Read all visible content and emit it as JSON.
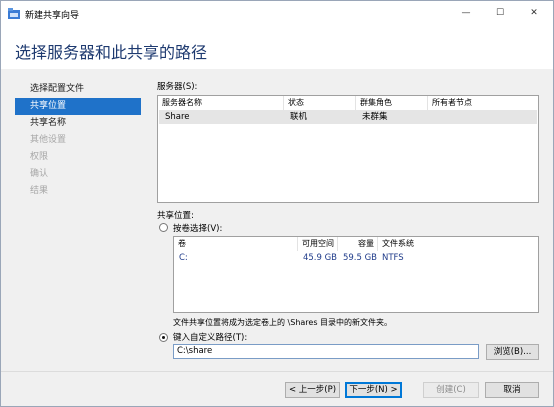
{
  "window": {
    "title": "新建共享向导",
    "minimize": "—",
    "maximize": "☐",
    "close": "✕"
  },
  "header": {
    "title": "选择服务器和此共享的路径"
  },
  "nav": {
    "items": [
      {
        "label": "选择配置文件"
      },
      {
        "label": "共享位置"
      },
      {
        "label": "共享名称"
      },
      {
        "label": "其他设置"
      },
      {
        "label": "权限"
      },
      {
        "label": "确认"
      },
      {
        "label": "结果"
      }
    ]
  },
  "servers": {
    "label": "服务器(S):",
    "columns": [
      "服务器名称",
      "状态",
      "群集角色",
      "所有者节点"
    ],
    "rows": [
      {
        "name": "Share",
        "status": "联机",
        "role": "未群集",
        "owner": ""
      }
    ]
  },
  "location": {
    "label": "共享位置:",
    "by_volume_label": "按卷选择(V):",
    "volume_columns": [
      "卷",
      "可用空间",
      "容量",
      "文件系统"
    ],
    "volumes": [
      {
        "volume": "C:",
        "free": "45.9 GB",
        "capacity": "59.5 GB",
        "fs": "NTFS"
      }
    ],
    "note": "文件共享位置将成为选定卷上的 \\Shares 目录中的新文件夹。",
    "custom_path_label": "键入自定义路径(T):",
    "custom_path_value": "C:\\share",
    "browse_label": "浏览(B)..."
  },
  "footer": {
    "prev": "< 上一步(P)",
    "next": "下一步(N) >",
    "create": "创建(C)",
    "cancel": "取消"
  },
  "colors": {
    "accent": "#1f72c9",
    "title": "#1e3a70"
  }
}
